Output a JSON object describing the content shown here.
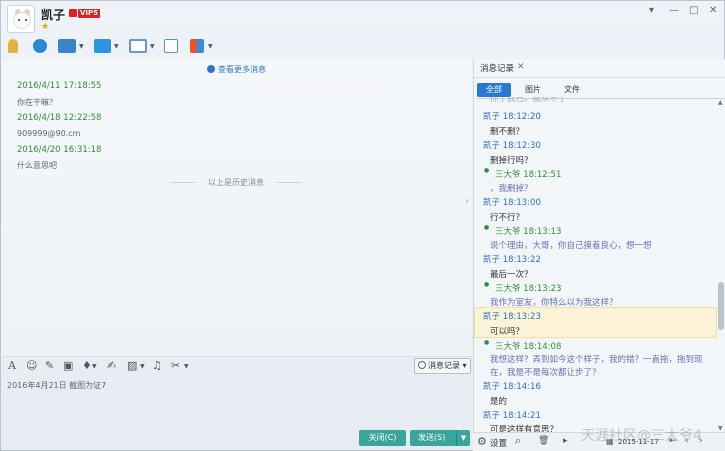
{
  "header": {
    "name": "凯子",
    "vip": "VIP5"
  },
  "chat": {
    "more_link": "查看更多消息",
    "history_divider": "以上是历史消息",
    "messages": [
      {
        "time": "2016/4/11 17:18:55",
        "text": "你在干嘛？"
      },
      {
        "time": "2016/4/18 12:22:58",
        "text": "909999@90.cm"
      },
      {
        "time": "2016/4/20 16:31:18",
        "text": "什么意思吧"
      }
    ]
  },
  "input": {
    "history_button": "消息记录",
    "draft": "2016年4月21日  截图为证7",
    "close_label": "关闭(C)",
    "send_label": "发送(S)"
  },
  "records": {
    "tab_label": "消息记录",
    "filters": [
      "全部",
      "图片",
      "文件"
    ],
    "top_partial": "你了我已，能从不了",
    "entries": [
      {
        "who": "me",
        "header": "凯子 18:12:20",
        "text": "删不删？"
      },
      {
        "who": "me",
        "header": "凯子 18:12:30",
        "text": "删掉行吗？"
      },
      {
        "who": "him",
        "header": "三大爷 18:12:51",
        "text": "，我删掉？"
      },
      {
        "who": "me",
        "header": "凯子 18:13:00",
        "text": "行不行？"
      },
      {
        "who": "him",
        "header": "三大爷 18:13:13",
        "text": "说个理由，大哥，你自己摸着良心，想一想"
      },
      {
        "who": "me",
        "header": "凯子 18:13:22",
        "text": "最后一次？"
      },
      {
        "who": "him",
        "header": "三大爷 18:13:23",
        "text": "我作为室友，你特么以为我这样？"
      },
      {
        "who": "me",
        "header": "凯子 18:13:23",
        "text": "可以吗？"
      },
      {
        "who": "him",
        "header": "三大爷 18:14:08",
        "text": "我想这样？弄到如今这个样子，我的错？一直拖，拖到现",
        "text2": "在，我是不是每次都让步了？"
      },
      {
        "who": "me",
        "header": "凯子 18:14:16",
        "text": "是的"
      },
      {
        "who": "me",
        "header": "凯子 18:14:21",
        "text": "可是这样有意思？"
      }
    ],
    "footer": {
      "settings": "设置",
      "date": "2015-11-17"
    }
  },
  "watermark": "天涯社区@三大爷4"
}
